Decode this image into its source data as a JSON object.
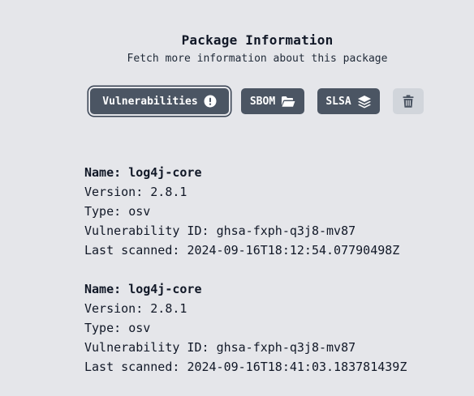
{
  "header": {
    "title": "Package Information",
    "subtitle": "Fetch more information about this package"
  },
  "toolbar": {
    "vulnerabilities_label": "Vulnerabilities",
    "sbom_label": "SBOM",
    "slsa_label": "SLSA"
  },
  "labels": {
    "name": "Name:",
    "version": "Version:",
    "type": "Type:",
    "vuln_id": "Vulnerability ID:",
    "last_scanned": "Last scanned:"
  },
  "results": [
    {
      "name": "log4j-core",
      "version": "2.8.1",
      "type": "osv",
      "vuln_id": "ghsa-fxph-q3j8-mv87",
      "last_scanned": "2024-09-16T18:12:54.07790498Z"
    },
    {
      "name": "log4j-core",
      "version": "2.8.1",
      "type": "osv",
      "vuln_id": "ghsa-fxph-q3j8-mv87",
      "last_scanned": "2024-09-16T18:41:03.183781439Z"
    }
  ],
  "icons": {
    "vulnerabilities": "exclamation-circle-icon",
    "sbom": "folder-open-icon",
    "slsa": "layer-group-icon",
    "delete": "trash-icon"
  },
  "colors": {
    "background": "#e5e6ea",
    "button": "#4b5563",
    "button_text": "#ffffff",
    "trash_button": "#d1d5db",
    "text": "#111827"
  }
}
